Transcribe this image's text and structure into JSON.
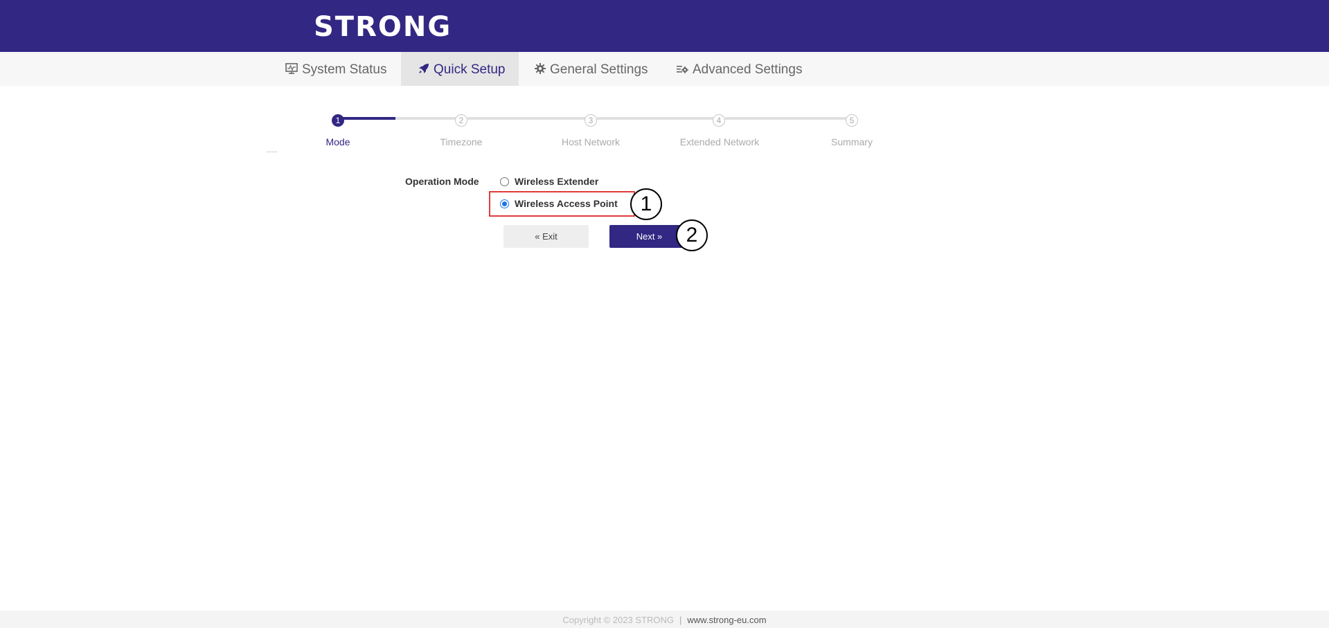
{
  "brand": {
    "logo_text": "STRONG",
    "color": "#322783"
  },
  "nav": {
    "tabs": [
      {
        "label": "System Status",
        "icon": "monitor-icon"
      },
      {
        "label": "Quick Setup",
        "icon": "rocket-icon",
        "active": true
      },
      {
        "label": "General Settings",
        "icon": "gear-icon"
      },
      {
        "label": "Advanced Settings",
        "icon": "sliders-gear-icon"
      }
    ]
  },
  "wizard": {
    "current_step": 1,
    "steps": [
      {
        "number": "1",
        "label": "Mode"
      },
      {
        "number": "2",
        "label": "Timezone"
      },
      {
        "number": "3",
        "label": "Host Network"
      },
      {
        "number": "4",
        "label": "Extended Network"
      },
      {
        "number": "5",
        "label": "Summary"
      }
    ],
    "dots": "----"
  },
  "form": {
    "operation_mode_label": "Operation Mode",
    "options": [
      {
        "label": "Wireless Extender",
        "checked": false
      },
      {
        "label": "Wireless Access Point",
        "checked": true
      }
    ],
    "exit_label": "« Exit",
    "next_label": "Next »"
  },
  "annotations": {
    "first": "1",
    "second": "2"
  },
  "footer": {
    "copyright": "Copyright © 2023 STRONG",
    "separator": "|",
    "website": "www.strong-eu.com"
  }
}
